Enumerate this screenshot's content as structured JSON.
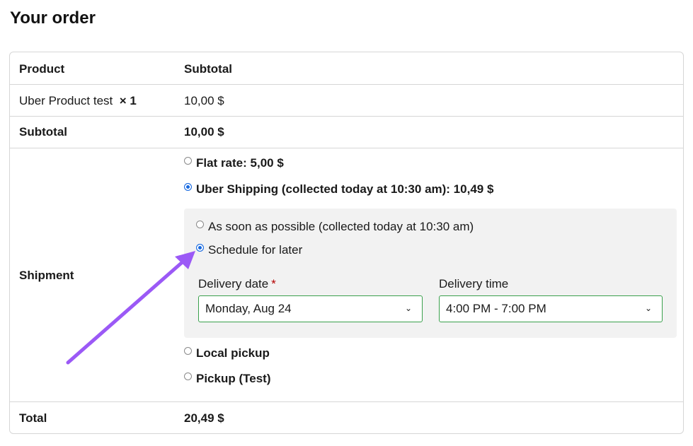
{
  "page": {
    "title": "Your order"
  },
  "table": {
    "headers": {
      "product": "Product",
      "subtotal": "Subtotal"
    },
    "line_item": {
      "name": "Uber Product test",
      "qty": "× 1",
      "price": "10,00 $"
    },
    "subtotal_row": {
      "label": "Subtotal",
      "value": "10,00 $"
    },
    "shipment": {
      "label": "Shipment",
      "options": [
        {
          "label": "Flat rate: 5,00 $",
          "checked": false
        },
        {
          "label": "Uber Shipping (collected today at 10:30 am): 10,49 $",
          "checked": true
        },
        {
          "label": "Local pickup",
          "checked": false
        },
        {
          "label": "Pickup (Test)",
          "checked": false
        }
      ],
      "uber": {
        "options": [
          {
            "label": "As soon as possible (collected today at 10:30 am)",
            "checked": false
          },
          {
            "label": "Schedule for later",
            "checked": true
          }
        ],
        "delivery_date": {
          "label": "Delivery date",
          "required_mark": "*",
          "value": "Monday, Aug 24"
        },
        "delivery_time": {
          "label": "Delivery time",
          "value": "4:00 PM - 7:00 PM"
        }
      }
    },
    "total_row": {
      "label": "Total",
      "value": "20,49 $"
    }
  },
  "colors": {
    "accent": "#1769e0",
    "arrow": "#9b59f6",
    "select_border": "#3aa04c",
    "required": "#b30000"
  }
}
